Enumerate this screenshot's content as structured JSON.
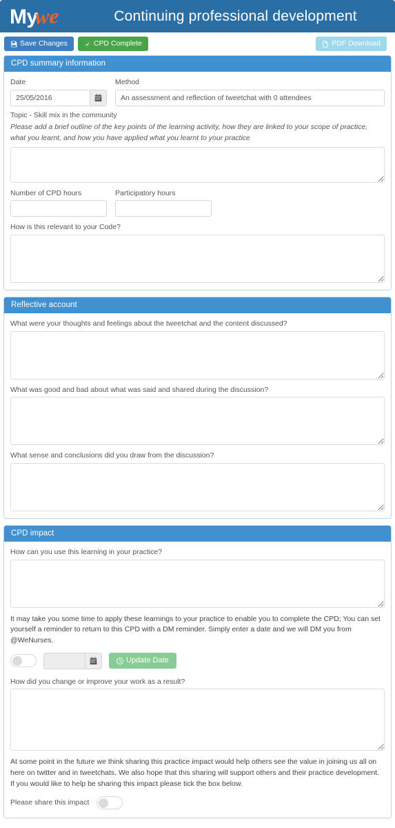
{
  "header": {
    "logo_primary": "My",
    "logo_accent": "we",
    "title": "Continuing professional development",
    "bg_color": "#2A6EA6",
    "accent_color": "#E8622A"
  },
  "toolbar": {
    "save_label": "Save Changes",
    "complete_label": "CPD Complete",
    "pdf_label": "PDF Download",
    "save_color": "#3E7FC1",
    "complete_color": "#47A447",
    "pdf_color": "#9ED8EC"
  },
  "summary": {
    "heading": "CPD summary information",
    "date_label": "Date",
    "date_value": "25/05/2016",
    "method_label": "Method",
    "method_value": "An assessment and reflection of tweetchat with 0 attendees",
    "topic_label": "Topic - Skill mix in the community",
    "outline_help": "Please add a brief outline of the key points of the learning activity, how they are linked to your scope of practice, what you learnt, and how you have applied what you learnt to your practice",
    "outline_value": "",
    "cpd_hours_label": "Number of CPD hours",
    "cpd_hours_value": "",
    "participatory_label": "Participatory hours",
    "participatory_value": "",
    "code_label": "How is this relevant to your Code?",
    "code_value": ""
  },
  "reflective": {
    "heading": "Reflective account",
    "q1_label": "What were your thoughts and feelings about the tweetchat and the content discussed?",
    "q1_value": "",
    "q2_label": "What was good and bad about what was said and shared during the discussion?",
    "q2_value": "",
    "q3_label": "What sense and conclusions did you draw from the discussion?",
    "q3_value": ""
  },
  "impact": {
    "heading": "CPD impact",
    "use_label": "How can you use this learning in your practice?",
    "use_value": "",
    "reminder_text": "It may take you some time to apply these learnings to your practice to enable you to complete the CPD; You can set yourself a reminder to return to this CPD with a DM reminder. Simply enter a date and we will DM you from @WeNurses.",
    "reminder_toggle_on": false,
    "reminder_date_value": "",
    "update_date_label": "Update Date",
    "update_date_color": "#86CC94",
    "change_label": "How did you change or improve your work as a result?",
    "change_value": "",
    "share_text": "At some point in the future we think sharing this practice impact would help others see the value in joining us all on here on twitter and in tweetchats. We also hope that this sharing will support others and their practice development. If you would like to help be sharing this impact please tick the box below.",
    "share_label": "Please share this impact",
    "share_toggle_on": false
  },
  "icons": {
    "save": "save-icon",
    "complete": "check-circle-icon",
    "pdf": "file-pdf-icon",
    "calendar": "calendar-icon",
    "clock": "clock-icon"
  }
}
